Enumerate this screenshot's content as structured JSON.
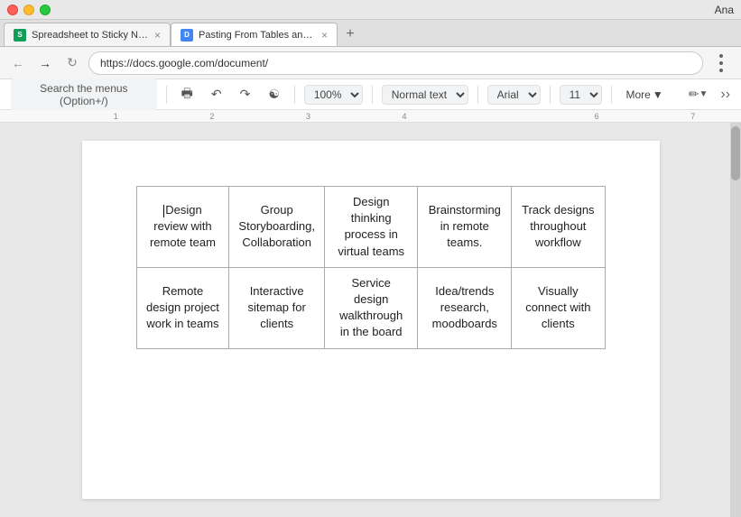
{
  "titleBar": {
    "user": "Ana"
  },
  "tabs": [
    {
      "id": "tab1",
      "label": "Spreadsheet to Sticky Not…",
      "favicon": "sheets",
      "active": false
    },
    {
      "id": "tab2",
      "label": "Pasting From Tables and S…",
      "favicon": "docs",
      "active": true
    }
  ],
  "addressBar": {
    "url": "https://docs.google.com/document/"
  },
  "toolbar": {
    "searchPlaceholder": "Search the menus (Option+/)",
    "zoom": "100%",
    "style": "Normal text",
    "font": "Arial",
    "size": "11",
    "more": "More"
  },
  "ruler": {
    "marks": [
      "1",
      "2",
      "3",
      "4",
      "6",
      "7"
    ]
  },
  "table": {
    "rows": [
      [
        "Design review with remote team",
        "Group Storyboarding, Collaboration",
        "Design thinking process in virtual teams",
        "Brainstorming in remote teams.",
        "Track designs throughout workflow"
      ],
      [
        "Remote design project work in teams",
        "Interactive sitemap for clients",
        "Service design walkthrough in the board",
        "Idea/trends research, moodboards",
        "Visually connect with clients"
      ]
    ]
  }
}
